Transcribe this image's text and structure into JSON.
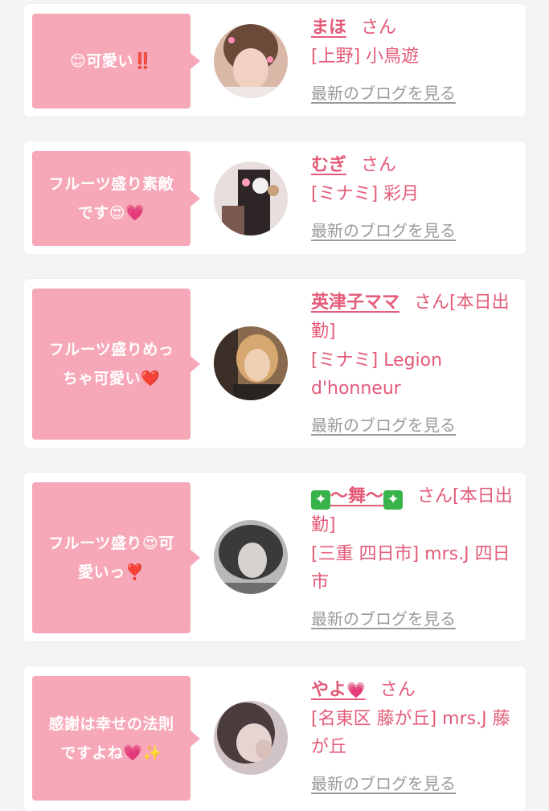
{
  "icons": {
    "smile": "😊",
    "double_exclaim": "‼️",
    "heart_eyes": "😍",
    "pink_heart": "💗",
    "red_heart": "❤️",
    "red_exclaim": "❣️",
    "sparkle_box": "✦",
    "sparkles": "✨"
  },
  "colors": {
    "accent": "#e35b78",
    "bubble": "#f7a8b8",
    "link_gray": "#9a9a9a"
  },
  "honorific": "さん",
  "blog_link_label": "最新のブログを見る",
  "entries": [
    {
      "comment_a": "可愛い",
      "name": "まほ",
      "honorific": "さん",
      "shop": "[上野] 小鳥遊"
    },
    {
      "comment_a": "フルーツ盛り素敵",
      "comment_b": "です",
      "name": "むぎ",
      "honorific": "さん",
      "shop": "[ミナミ] 彩月"
    },
    {
      "comment_a": "フルーツ盛りめっ",
      "comment_b": "ちゃ可愛い",
      "name": "英津子ママ",
      "honorific": "さん[本日出勤]",
      "shop": "[ミナミ] Legion d'honneur"
    },
    {
      "comment_a": "フルーツ盛り",
      "comment_b": "可",
      "comment_c": "愛いっ",
      "name_mid": "〜舞〜",
      "honorific": "さん[本日出勤]",
      "shop": "[三重 四日市] mrs.J 四日市"
    },
    {
      "comment_a": "感謝は幸せの法則",
      "comment_b": "ですよね",
      "name": "やよ",
      "honorific": "さん",
      "shop": "[名東区 藤が丘] mrs.J 藤が丘"
    }
  ]
}
